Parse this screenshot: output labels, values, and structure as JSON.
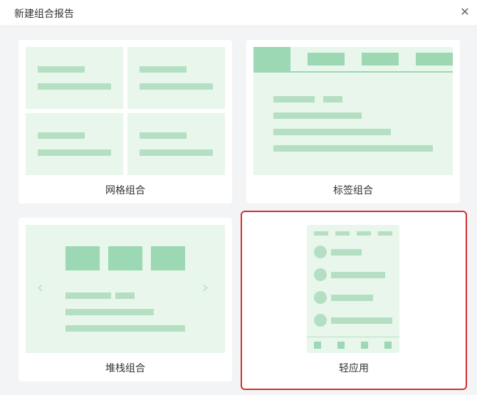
{
  "dialog": {
    "title": "新建组合报告",
    "close_icon": "close-icon"
  },
  "options": [
    {
      "label": "网格组合",
      "selected": false
    },
    {
      "label": "标签组合",
      "selected": false
    },
    {
      "label": "堆栈组合",
      "selected": false
    },
    {
      "label": "轻应用",
      "selected": true
    }
  ],
  "colors": {
    "preview_bg": "#e8f6ec",
    "bar": "#b5dfc3",
    "block": "#9bd8b3",
    "selected_outline": "#d32f2f"
  }
}
